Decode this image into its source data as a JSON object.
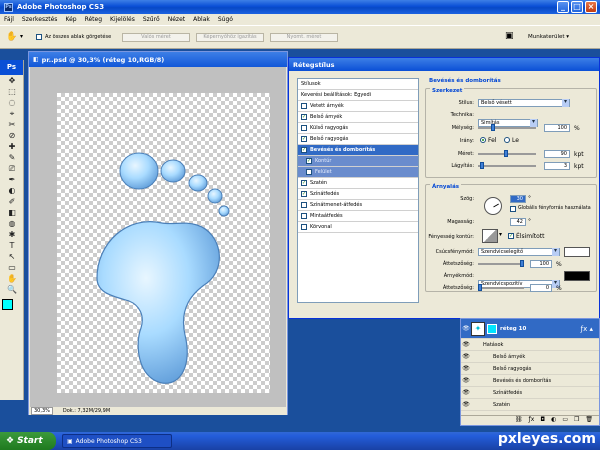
{
  "window": {
    "title": "Adobe Photoshop CS3"
  },
  "menu": [
    "Fájl",
    "Szerkesztés",
    "Kép",
    "Réteg",
    "Kijelölés",
    "Szűrő",
    "Nézet",
    "Ablak",
    "Súgó"
  ],
  "options": {
    "checkbox_label": "Az összes ablak görgetése",
    "btn1": "Valós méret",
    "btn2": "Képernyőhöz igazítás",
    "btn3": "Nyomt. méret",
    "workspace": "Munkaterület ▾"
  },
  "doc": {
    "title": "pr..psd @ 30,3% (réteg 10,RGB/8)",
    "zoom": "30,3%",
    "size": "Dok.: 7,32M/29,9M"
  },
  "tools": [
    "✥",
    "⬚",
    "◌",
    "⌖",
    "✂",
    "⊘",
    "✚",
    "✎",
    "⎚",
    "✒",
    "◐",
    "✐",
    "◧",
    "◍",
    "✱",
    "T",
    "↖",
    "▭",
    "✋",
    "🔍"
  ],
  "dialog": {
    "title": "Rétegstílus",
    "list": [
      {
        "label": "Stílusok",
        "check": false,
        "kind": "plain"
      },
      {
        "label": "Keverési beállítások: Egyedi",
        "check": false,
        "kind": "plain"
      },
      {
        "label": "Vetett árnyék",
        "check": false,
        "kind": "cb"
      },
      {
        "label": "Belső árnyék",
        "check": true,
        "kind": "cb"
      },
      {
        "label": "Külső ragyogás",
        "check": false,
        "kind": "cb"
      },
      {
        "label": "Belső ragyogás",
        "check": true,
        "kind": "cb"
      },
      {
        "label": "Bevésés és domborítás",
        "check": true,
        "kind": "sel"
      },
      {
        "label": "Kontúr",
        "check": true,
        "kind": "sub"
      },
      {
        "label": "Felület",
        "check": false,
        "kind": "sub"
      },
      {
        "label": "Szatén",
        "check": true,
        "kind": "cb"
      },
      {
        "label": "Színátfedés",
        "check": true,
        "kind": "cb"
      },
      {
        "label": "Színátmenet-átfedés",
        "check": false,
        "kind": "cb"
      },
      {
        "label": "Mintaátfedés",
        "check": false,
        "kind": "cb"
      },
      {
        "label": "Körvonal",
        "check": false,
        "kind": "cb"
      }
    ],
    "section": "Bevésés és domborítás",
    "structure": "Szerkezet",
    "style_label": "Stílus:",
    "style_val": "Belső vésett",
    "tech_label": "Technika:",
    "tech_val": "Simítás",
    "depth_label": "Mélység:",
    "depth_val": "100",
    "pct": "%",
    "dir_label": "Irány:",
    "dir_up": "Fel",
    "dir_down": "Le",
    "size_label": "Méret:",
    "size_val": "90",
    "px": "kpt",
    "soften_label": "Lágyítás:",
    "soften_val": "3",
    "shading": "Árnyalás",
    "angle_label": "Szög:",
    "angle_val": "30",
    "deg": "°",
    "global_label": "Globális fényforrás használata",
    "alt_label": "Magasság:",
    "alt_val": "42",
    "gloss_label": "Fényesség kontúr:",
    "aa_label": "Élsimított",
    "hl_label": "Csúcsfénymód:",
    "hl_val": "Szendvicselegítő",
    "op1_label": "Áttetszőség:",
    "op1_val": "100",
    "sh_label": "Árnyékmód:",
    "sh_val": "Szendvicspozitív",
    "op2_label": "Áttetszőség:",
    "op2_val": "0"
  },
  "layers": {
    "name": "réteg 10",
    "effects": "Hatások",
    "items": [
      "Belső árnyék",
      "Belső ragyogás",
      "Bevésés és domborítás",
      "Színátfedés",
      "Szatén"
    ]
  },
  "taskbar": {
    "start": "Start",
    "task": "Adobe Photoshop CS3",
    "watermark": "pxleyes.com"
  },
  "colors": {
    "accent": "#316ac5",
    "swatch": "#00ffff"
  }
}
